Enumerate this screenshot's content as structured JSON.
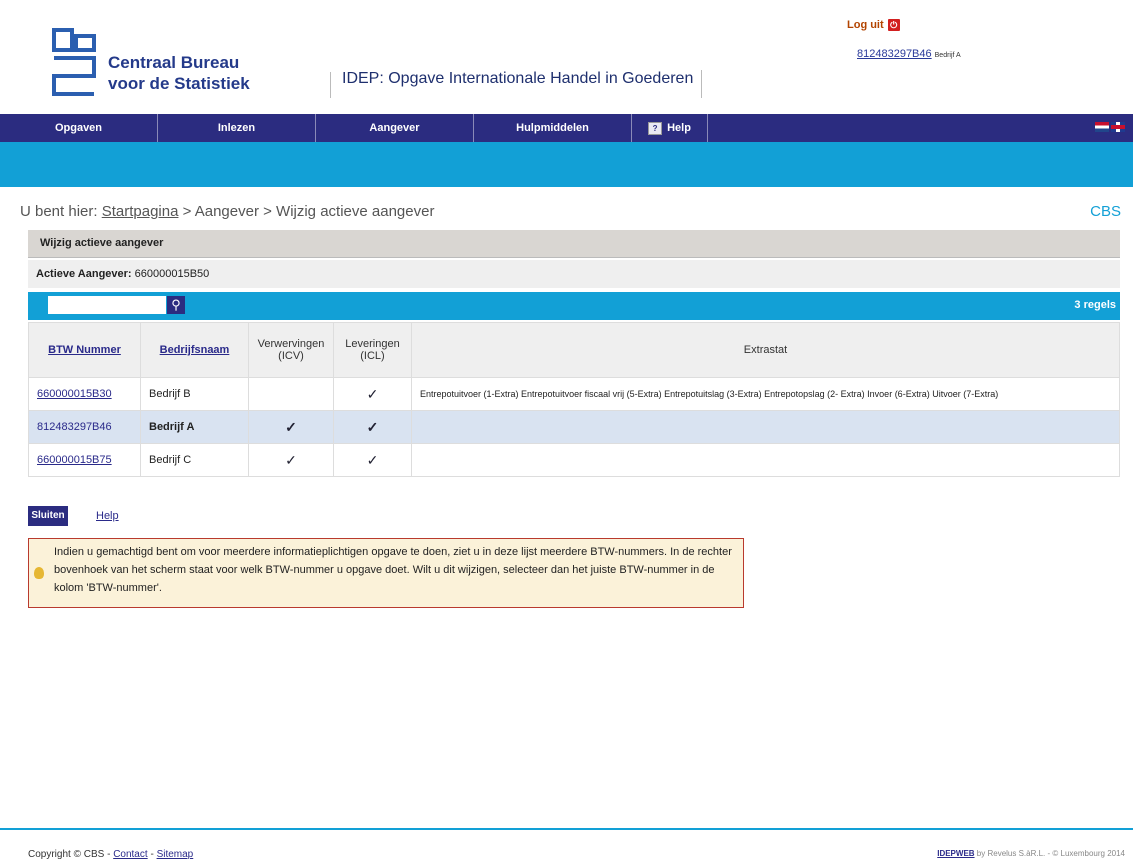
{
  "header": {
    "org_line1": "Centraal Bureau",
    "org_line2": "voor de Statistiek",
    "app_title": "IDEP: Opgave Internationale Handel in Goederen",
    "logout_label": "Log uit",
    "user_vat": "812483297B46",
    "user_company": "Bedrijf A"
  },
  "nav": {
    "items": [
      "Opgaven",
      "Inlezen",
      "Aangever",
      "Hulpmiddelen",
      "Help"
    ]
  },
  "breadcrumb": {
    "prefix": "U bent hier:",
    "home": "Startpagina",
    "rest": "> Aangever > Wijzig actieve aangever",
    "cbs_link": "CBS"
  },
  "panel": {
    "title": "Wijzig actieve aangever",
    "active_label": "Actieve Aangever:",
    "active_value": "660000015B50",
    "search_placeholder": "",
    "rows_count": "3 regels"
  },
  "table": {
    "headers": {
      "btw": "BTW Nummer",
      "name": "Bedrijfsnaam",
      "icv_1": "Verwervingen",
      "icv_2": "(ICV)",
      "icl_1": "Leveringen",
      "icl_2": "(ICL)",
      "extrastat": "Extrastat"
    },
    "rows": [
      {
        "btw": "660000015B30",
        "name": "Bedrijf B",
        "icv": "",
        "icl": "✓",
        "extrastat": "Entrepotuitvoer (1-Extra) Entrepotuitvoer fiscaal vrij (5-Extra) Entrepotuitslag (3-Extra) Entrepotopslag (2- Extra) Invoer (6-Extra) Uitvoer (7-Extra)"
      },
      {
        "btw": "812483297B46",
        "name": "Bedrijf A",
        "icv": "✓",
        "icl": "✓",
        "extrastat": ""
      },
      {
        "btw": "660000015B75",
        "name": "Bedrijf C",
        "icv": "✓",
        "icl": "✓",
        "extrastat": ""
      }
    ]
  },
  "actions": {
    "close_label": "Sluiten",
    "help_label": "Help"
  },
  "info": {
    "text": "Indien u gemachtigd bent om voor meerdere informatieplichtigen opgave te doen, ziet u in deze lijst meerdere BTW-nummers. In de rechter bovenhoek van het scherm staat voor welk BTW-nummer u opgave doet. Wilt u dit wijzigen, selecteer dan het juiste BTW-nummer in de kolom 'BTW-nummer'."
  },
  "footer": {
    "copyright": "Copyright © CBS -",
    "contact": "Contact",
    "sep": "-",
    "sitemap": "Sitemap",
    "credit_link": "IDEPWEB",
    "credit_rest": "by Revelus S.àR.L. - © Luxembourg 2014"
  },
  "colors": {
    "nav": "#2b2c80",
    "accent": "#12a0d6",
    "info_border": "#b93a2e"
  }
}
